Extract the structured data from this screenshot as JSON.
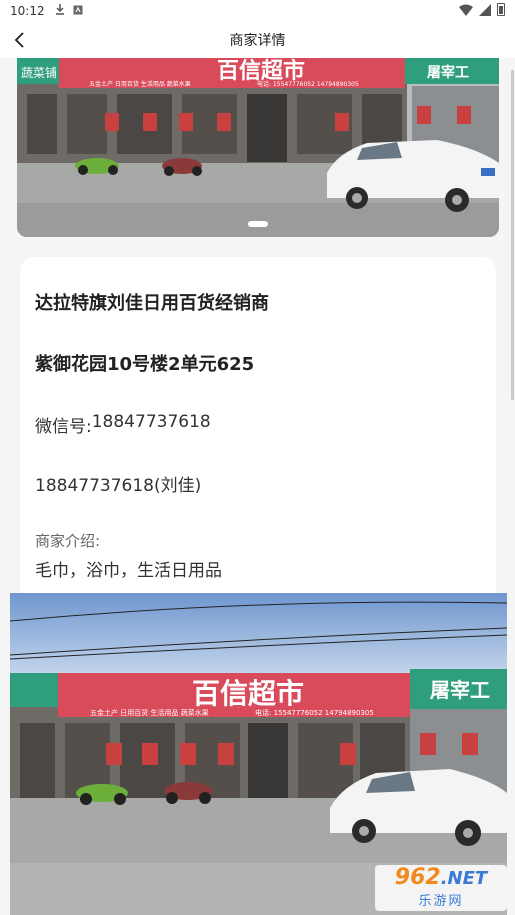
{
  "status_bar": {
    "time": "10:12"
  },
  "nav": {
    "title": "商家详情"
  },
  "merchant": {
    "name": "达拉特旗刘佳日用百货经销商",
    "address": "紫御花园10号楼2单元625",
    "wechat_label": "微信号:",
    "wechat_value": "18847737618",
    "phone": "18847737618(刘佳)",
    "intro_label": "商家介绍:",
    "intro_text": "毛巾，浴巾，生活日用品"
  },
  "shop_sign": {
    "main_name": "百信超市",
    "sub_line": "五金土产  日用百货  生活用品  蔬菜水果",
    "tel_line": "电话: 15547776052  14794890305",
    "side_sign": "屠宰工",
    "left_sign": "蔬菜铺"
  },
  "watermark": {
    "brand": "962",
    "domain": ".NET",
    "name": "乐游网"
  }
}
